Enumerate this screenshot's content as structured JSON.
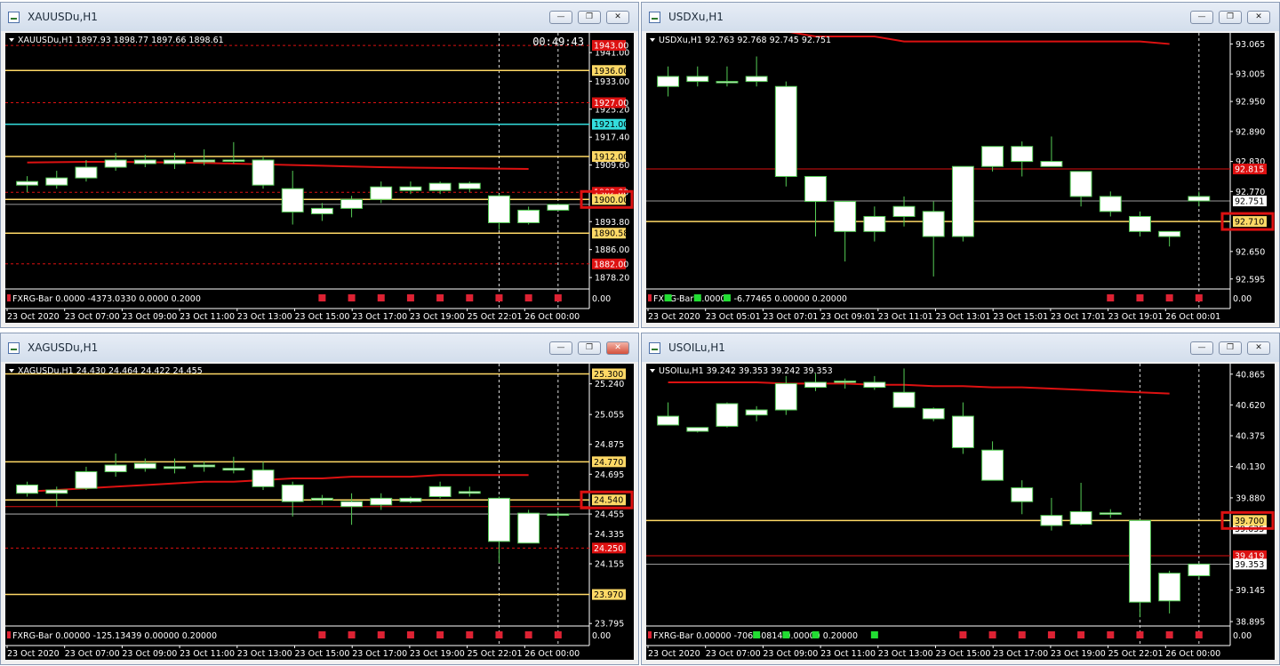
{
  "colors": {
    "bg": "#000000",
    "grid": "#7a7a7a",
    "bull_fill": "#ffffff",
    "bear_fill": "#ffffff",
    "wick": "#55cc55",
    "body_border": "#55cc55",
    "ma": "#dd1111",
    "level_yellow": "#ffd966",
    "level_red": "#dd1111",
    "cyan": "#33dddd",
    "highlight": "#dd1111",
    "indicator_red": "#dd2233",
    "indicator_green": "#22dd33"
  },
  "windows": [
    {
      "title": "XAUUSDu,H1",
      "close_red": false,
      "header": "XAUUSDu,H1  1897.93 1898.77 1897.66 1898.61",
      "timer": "00:49:43",
      "indicator": "FXRG-Bar 0.0000 -4373.0330 0.0000 0.2000",
      "ind_scale": "0.00",
      "x_labels": [
        "23 Oct 2020",
        "23 Oct 07:00",
        "23 Oct 09:00",
        "23 Oct 11:00",
        "23 Oct 13:00",
        "23 Oct 15:00",
        "23 Oct 17:00",
        "23 Oct 19:00",
        "25 Oct 22:01",
        "26 Oct 00:00"
      ],
      "y_range": [
        1875.0,
        1945.5
      ],
      "y_ticks": [
        "1941.00",
        "1933.00",
        "1925.20",
        "1917.40",
        "1909.60",
        "1893.80",
        "1886.00",
        "1878.20"
      ],
      "boxed_labels": [
        {
          "text": "1943.00",
          "kind": "red"
        },
        {
          "text": "1936.00",
          "kind": "yellow"
        },
        {
          "text": "1927.00",
          "kind": "red"
        },
        {
          "text": "1921.00",
          "kind": "cyan"
        },
        {
          "text": "1912.00",
          "kind": "yellow"
        },
        {
          "text": "1902.00",
          "kind": "red"
        },
        {
          "text": "1890.58",
          "kind": "yellow"
        },
        {
          "text": "1882.00",
          "kind": "red"
        }
      ],
      "current": {
        "text": "1900.00",
        "highlight": true
      },
      "levels": [
        {
          "y": 1943.0,
          "kind": "red_dash"
        },
        {
          "y": 1936.0,
          "kind": "yellow"
        },
        {
          "y": 1927.0,
          "kind": "red_dash"
        },
        {
          "y": 1921.0,
          "kind": "cyan"
        },
        {
          "y": 1912.0,
          "kind": "yellow"
        },
        {
          "y": 1902.0,
          "kind": "red_dash"
        },
        {
          "y": 1900.0,
          "kind": "yellow"
        },
        {
          "y": 1898.61,
          "kind": "grey"
        },
        {
          "y": 1890.58,
          "kind": "yellow"
        },
        {
          "y": 1882.0,
          "kind": "red_dash"
        }
      ],
      "ma": [
        1910.3,
        1910.4,
        1910.5,
        1910.5,
        1910.4,
        1910.3,
        1910.2,
        1910.0,
        1909.8,
        1909.6,
        1909.4,
        1909.2,
        1909.0,
        1908.9,
        1908.8,
        1908.7,
        1908.6,
        1908.5
      ],
      "candles": [
        [
          1905.0,
          1906.5,
          1902.0,
          1904.0
        ],
        [
          1904.0,
          1908.0,
          1903.0,
          1906.0
        ],
        [
          1906.0,
          1911.0,
          1905.0,
          1909.0
        ],
        [
          1909.0,
          1913.0,
          1908.0,
          1911.0
        ],
        [
          1911.0,
          1912.5,
          1909.0,
          1910.0
        ],
        [
          1910.0,
          1913.0,
          1908.5,
          1911.0
        ],
        [
          1910.5,
          1914.0,
          1909.5,
          1911.0
        ],
        [
          1911.0,
          1916.0,
          1910.0,
          1911.0
        ],
        [
          1911.0,
          1912.0,
          1903.0,
          1904.0
        ],
        [
          1903.0,
          1908.0,
          1893.0,
          1896.5
        ],
        [
          1896.0,
          1899.0,
          1894.0,
          1897.5
        ],
        [
          1897.5,
          1901.0,
          1895.0,
          1900.0
        ],
        [
          1900.0,
          1905.0,
          1899.0,
          1903.5
        ],
        [
          1902.5,
          1905.0,
          1901.5,
          1903.5
        ],
        [
          1902.5,
          1905.0,
          1901.5,
          1904.5
        ],
        [
          1904.5,
          1905.0,
          1902.0,
          1903.0
        ],
        [
          1901.0,
          1901.5,
          1891.5,
          1893.5
        ],
        [
          1897.0,
          1898.0,
          1893.0,
          1893.5
        ],
        [
          1897.0,
          1898.8,
          1897.0,
          1898.6
        ]
      ],
      "ind_markers": [
        10,
        11,
        12,
        13,
        14,
        15,
        16,
        17,
        18
      ],
      "ind_color": "red",
      "vlines": [
        16,
        18
      ]
    },
    {
      "title": "USDXu,H1",
      "close_red": false,
      "header": "USDXu,H1  92.763 92.768 92.745 92.751",
      "timer": "",
      "indicator": "FXRG-Bar 0.00000 -6.77465 0.00000 0.20000",
      "ind_scale": "0.00",
      "x_labels": [
        "23 Oct 2020",
        "23 Oct 05:01",
        "23 Oct 07:01",
        "23 Oct 09:01",
        "23 Oct 11:01",
        "23 Oct 13:01",
        "23 Oct 15:01",
        "23 Oct 17:01",
        "23 Oct 19:01",
        "26 Oct 00:01"
      ],
      "y_range": [
        92.575,
        93.08
      ],
      "y_ticks": [
        "93.065",
        "93.005",
        "92.950",
        "92.890",
        "92.830",
        "92.770",
        "92.650",
        "92.595"
      ],
      "boxed_labels": [
        {
          "text": "92.815",
          "kind": "red"
        },
        {
          "text": "92.751",
          "kind": "grey"
        }
      ],
      "current": {
        "text": "92.710",
        "highlight": true
      },
      "levels": [
        {
          "y": 92.815,
          "kind": "red"
        },
        {
          "y": 92.751,
          "kind": "grey"
        },
        {
          "y": 92.71,
          "kind": "yellow"
        }
      ],
      "ma": [
        93.11,
        93.1,
        93.1,
        93.09,
        93.09,
        93.08,
        93.08,
        93.08,
        93.07,
        93.07,
        93.07,
        93.07,
        93.07,
        93.07,
        93.07,
        93.07,
        93.07,
        93.065
      ],
      "candles": [
        [
          93.0,
          93.02,
          92.96,
          92.98
        ],
        [
          92.99,
          93.02,
          92.98,
          93.0
        ],
        [
          92.99,
          93.02,
          92.98,
          92.99
        ],
        [
          92.99,
          93.04,
          92.98,
          93.0
        ],
        [
          92.98,
          92.99,
          92.78,
          92.8
        ],
        [
          92.8,
          92.8,
          92.68,
          92.75
        ],
        [
          92.75,
          92.75,
          92.63,
          92.69
        ],
        [
          92.69,
          92.74,
          92.67,
          92.72
        ],
        [
          92.72,
          92.76,
          92.7,
          92.74
        ],
        [
          92.73,
          92.75,
          92.6,
          92.68
        ],
        [
          92.68,
          92.82,
          92.67,
          92.82
        ],
        [
          92.82,
          92.86,
          92.81,
          92.86
        ],
        [
          92.86,
          92.87,
          92.8,
          92.83
        ],
        [
          92.83,
          92.88,
          92.82,
          92.82
        ],
        [
          92.81,
          92.81,
          92.74,
          92.76
        ],
        [
          92.76,
          92.77,
          92.72,
          92.73
        ],
        [
          92.72,
          92.73,
          92.68,
          92.69
        ],
        [
          92.69,
          92.69,
          92.66,
          92.68
        ],
        [
          92.76,
          92.77,
          92.74,
          92.751
        ]
      ],
      "ind_markers": [
        0,
        1,
        2,
        15,
        16,
        17,
        18
      ],
      "ind_color": "mixed",
      "vlines": [
        18
      ]
    },
    {
      "title": "XAGUSDu,H1",
      "close_red": true,
      "header": "XAGUSDu,H1  24.430 24.464 24.422 24.455",
      "timer": "",
      "indicator": "FXRG-Bar 0.00000 -125.13439 0.00000 0.20000",
      "ind_scale": "0.00",
      "x_labels": [
        "23 Oct 2020",
        "23 Oct 07:00",
        "23 Oct 09:00",
        "23 Oct 11:00",
        "23 Oct 13:00",
        "23 Oct 15:00",
        "23 Oct 17:00",
        "23 Oct 19:00",
        "25 Oct 22:01",
        "26 Oct 00:00"
      ],
      "y_range": [
        23.78,
        25.34
      ],
      "y_ticks": [
        "25.240",
        "25.055",
        "24.875",
        "24.695",
        "24.455",
        "24.335",
        "24.155",
        "23.795"
      ],
      "boxed_labels": [
        {
          "text": "25.300",
          "kind": "yellow"
        },
        {
          "text": "24.770",
          "kind": "yellow"
        },
        {
          "text": "24.250",
          "kind": "red"
        },
        {
          "text": "23.970",
          "kind": "yellow"
        }
      ],
      "current": {
        "text": "24.540",
        "highlight": true
      },
      "levels": [
        {
          "y": 25.3,
          "kind": "yellow"
        },
        {
          "y": 24.77,
          "kind": "yellow"
        },
        {
          "y": 24.54,
          "kind": "yellow"
        },
        {
          "y": 24.5,
          "kind": "red"
        },
        {
          "y": 24.455,
          "kind": "grey"
        },
        {
          "y": 24.25,
          "kind": "red_dash"
        },
        {
          "y": 23.97,
          "kind": "yellow"
        }
      ],
      "ma": [
        24.59,
        24.6,
        24.61,
        24.62,
        24.63,
        24.64,
        24.65,
        24.65,
        24.66,
        24.67,
        24.67,
        24.68,
        24.68,
        24.68,
        24.69,
        24.69,
        24.69,
        24.69
      ],
      "candles": [
        [
          24.63,
          24.65,
          24.56,
          24.58
        ],
        [
          24.58,
          24.62,
          24.5,
          24.6
        ],
        [
          24.61,
          24.74,
          24.6,
          24.71
        ],
        [
          24.71,
          24.82,
          24.68,
          24.75
        ],
        [
          24.73,
          24.79,
          24.71,
          24.76
        ],
        [
          24.74,
          24.79,
          24.7,
          24.73
        ],
        [
          24.74,
          24.77,
          24.71,
          24.75
        ],
        [
          24.73,
          24.8,
          24.7,
          24.72
        ],
        [
          24.72,
          24.77,
          24.6,
          24.62
        ],
        [
          24.63,
          24.65,
          24.44,
          24.53
        ],
        [
          24.54,
          24.57,
          24.51,
          24.55
        ],
        [
          24.53,
          24.58,
          24.39,
          24.5
        ],
        [
          24.51,
          24.58,
          24.48,
          24.55
        ],
        [
          24.55,
          24.56,
          24.52,
          24.53
        ],
        [
          24.62,
          24.65,
          24.55,
          24.56
        ],
        [
          24.59,
          24.62,
          24.56,
          24.58
        ],
        [
          24.55,
          24.56,
          24.16,
          24.29
        ],
        [
          24.28,
          24.48,
          24.28,
          24.46
        ],
        [
          24.45,
          24.47,
          24.43,
          24.455
        ]
      ],
      "ind_markers": [
        10,
        11,
        12,
        13,
        14,
        15,
        16,
        17,
        18
      ],
      "ind_color": "red",
      "vlines": [
        16,
        18
      ]
    },
    {
      "title": "USOILu,H1",
      "close_red": false,
      "header": "USOILu,H1  39.242 39.353 39.242 39.353",
      "timer": "",
      "indicator": "FXRG-Bar 0.00000 -706.40814 0.00000 0.20000",
      "ind_scale": "0.00",
      "x_labels": [
        "23 Oct 2020",
        "23 Oct 07:00",
        "23 Oct 09:00",
        "23 Oct 11:00",
        "23 Oct 13:00",
        "23 Oct 15:00",
        "23 Oct 17:00",
        "23 Oct 19:00",
        "25 Oct 22:01",
        "26 Oct 00:00"
      ],
      "y_range": [
        38.86,
        40.92
      ],
      "y_ticks": [
        "40.865",
        "40.620",
        "40.375",
        "40.130",
        "39.880",
        "39.145",
        "38.895"
      ],
      "boxed_labels": [
        {
          "text": "39.635",
          "kind": "grey"
        },
        {
          "text": "39.419",
          "kind": "red"
        },
        {
          "text": "39.353",
          "kind": "grey"
        }
      ],
      "current": {
        "text": "39.700",
        "highlight": true
      },
      "levels": [
        {
          "y": 39.7,
          "kind": "yellow"
        },
        {
          "y": 39.419,
          "kind": "red"
        },
        {
          "y": 39.353,
          "kind": "grey"
        }
      ],
      "ma": [
        40.8,
        40.8,
        40.8,
        40.8,
        40.79,
        40.79,
        40.79,
        40.78,
        40.78,
        40.77,
        40.77,
        40.76,
        40.76,
        40.75,
        40.74,
        40.73,
        40.72,
        40.71
      ],
      "candles": [
        [
          40.53,
          40.64,
          40.46,
          40.46
        ],
        [
          40.41,
          40.44,
          40.4,
          40.44
        ],
        [
          40.45,
          40.64,
          40.44,
          40.63
        ],
        [
          40.54,
          40.61,
          40.49,
          40.58
        ],
        [
          40.58,
          40.85,
          40.54,
          40.79
        ],
        [
          40.76,
          40.87,
          40.73,
          40.8
        ],
        [
          40.81,
          40.83,
          40.75,
          40.8
        ],
        [
          40.8,
          40.85,
          40.74,
          40.76
        ],
        [
          40.72,
          40.91,
          40.6,
          40.6
        ],
        [
          40.59,
          40.6,
          40.49,
          40.51
        ],
        [
          40.53,
          40.64,
          40.23,
          40.28
        ],
        [
          40.26,
          40.33,
          40.07,
          40.02
        ],
        [
          39.96,
          40.02,
          39.75,
          39.85
        ],
        [
          39.74,
          39.88,
          39.62,
          39.66
        ],
        [
          39.67,
          40.0,
          39.66,
          39.77
        ],
        [
          39.75,
          39.79,
          39.72,
          39.76
        ],
        [
          39.7,
          39.71,
          38.93,
          39.05
        ],
        [
          39.06,
          39.3,
          38.96,
          39.28
        ],
        [
          39.26,
          39.36,
          39.24,
          39.353
        ]
      ],
      "ind_markers": [
        3,
        4,
        5,
        7,
        10,
        11,
        12,
        13,
        14,
        15,
        16,
        17,
        18
      ],
      "ind_color": "mixed2",
      "vlines": [
        16,
        18
      ]
    }
  ]
}
